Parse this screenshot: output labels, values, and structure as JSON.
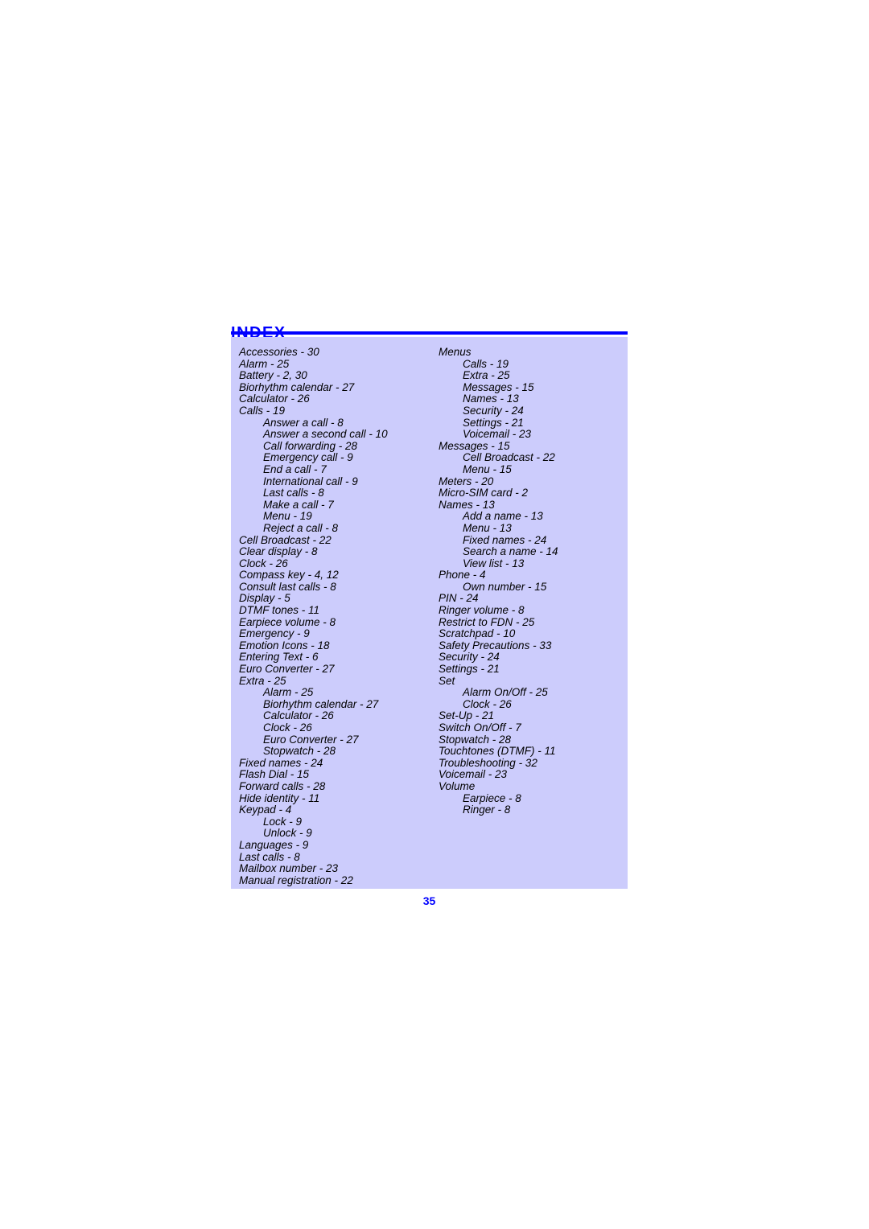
{
  "heading": {
    "title": "Index"
  },
  "page_number": "35",
  "colors": {
    "accent": "#0000FF",
    "panel_background": "#CCCCFC",
    "text": "#000000",
    "page_background": "#FFFFFF"
  },
  "index": {
    "left_column": [
      {
        "text": "Accessories - 30",
        "level": 0
      },
      {
        "text": "Alarm - 25",
        "level": 0
      },
      {
        "text": "Battery - 2, 30",
        "level": 0
      },
      {
        "text": "Biorhythm calendar - 27",
        "level": 0
      },
      {
        "text": "Calculator - 26",
        "level": 0
      },
      {
        "text": "Calls - 19",
        "level": 0
      },
      {
        "text": "Answer a call - 8",
        "level": 1
      },
      {
        "text": "Answer a second call - 10",
        "level": 1
      },
      {
        "text": "Call forwarding - 28",
        "level": 1
      },
      {
        "text": "Emergency call - 9",
        "level": 1
      },
      {
        "text": "End a call - 7",
        "level": 1
      },
      {
        "text": "International call - 9",
        "level": 1
      },
      {
        "text": "Last calls - 8",
        "level": 1
      },
      {
        "text": "Make a call - 7",
        "level": 1
      },
      {
        "text": "Menu - 19",
        "level": 1
      },
      {
        "text": "Reject a call - 8",
        "level": 1
      },
      {
        "text": "Cell Broadcast - 22",
        "level": 0
      },
      {
        "text": "Clear display - 8",
        "level": 0
      },
      {
        "text": "Clock - 26",
        "level": 0
      },
      {
        "text": "Compass key - 4, 12",
        "level": 0
      },
      {
        "text": "Consult last calls - 8",
        "level": 0
      },
      {
        "text": "Display - 5",
        "level": 0
      },
      {
        "text": "DTMF tones - 11",
        "level": 0
      },
      {
        "text": "Earpiece volume - 8",
        "level": 0
      },
      {
        "text": "Emergency - 9",
        "level": 0
      },
      {
        "text": "Emotion Icons - 18",
        "level": 0
      },
      {
        "text": "Entering Text - 6",
        "level": 0
      },
      {
        "text": "Euro Converter - 27",
        "level": 0
      },
      {
        "text": "Extra - 25",
        "level": 0
      },
      {
        "text": "Alarm - 25",
        "level": 1
      },
      {
        "text": "Biorhythm calendar - 27",
        "level": 1
      },
      {
        "text": "Calculator - 26",
        "level": 1
      },
      {
        "text": "Clock - 26",
        "level": 1
      },
      {
        "text": "Euro Converter - 27",
        "level": 1
      },
      {
        "text": "Stopwatch - 28",
        "level": 1
      },
      {
        "text": "Fixed names - 24",
        "level": 0
      },
      {
        "text": "Flash Dial - 15",
        "level": 0
      },
      {
        "text": "Forward calls - 28",
        "level": 0
      },
      {
        "text": "Hide identity - 11",
        "level": 0
      },
      {
        "text": "Keypad - 4",
        "level": 0
      },
      {
        "text": "Lock - 9",
        "level": 1
      },
      {
        "text": "Unlock - 9",
        "level": 1
      },
      {
        "text": "Languages - 9",
        "level": 0
      },
      {
        "text": "Last calls - 8",
        "level": 0
      },
      {
        "text": "Mailbox number - 23",
        "level": 0
      },
      {
        "text": "Manual registration - 22",
        "level": 0
      }
    ],
    "right_column": [
      {
        "text": "Menus",
        "level": 0
      },
      {
        "text": "Calls - 19",
        "level": 1
      },
      {
        "text": "Extra - 25",
        "level": 1
      },
      {
        "text": "Messages - 15",
        "level": 1
      },
      {
        "text": "Names - 13",
        "level": 1
      },
      {
        "text": "Security - 24",
        "level": 1
      },
      {
        "text": "Settings - 21",
        "level": 1
      },
      {
        "text": "Voicemail - 23",
        "level": 1
      },
      {
        "text": "Messages - 15",
        "level": 0
      },
      {
        "text": "Cell Broadcast - 22",
        "level": 1
      },
      {
        "text": "Menu - 15",
        "level": 1
      },
      {
        "text": "Meters - 20",
        "level": 0
      },
      {
        "text": "Micro-SIM card - 2",
        "level": 0
      },
      {
        "text": "Names - 13",
        "level": 0
      },
      {
        "text": "Add a name - 13",
        "level": 1
      },
      {
        "text": "Menu - 13",
        "level": 1
      },
      {
        "text": "Fixed names - 24",
        "level": 1
      },
      {
        "text": "Search a name - 14",
        "level": 1
      },
      {
        "text": "View list - 13",
        "level": 1
      },
      {
        "text": "Phone - 4",
        "level": 0
      },
      {
        "text": "Own number - 15",
        "level": 1
      },
      {
        "text": "PIN - 24",
        "level": 0
      },
      {
        "text": "Ringer volume - 8",
        "level": 0
      },
      {
        "text": "Restrict to FDN - 25",
        "level": 0
      },
      {
        "text": "Scratchpad - 10",
        "level": 0
      },
      {
        "text": "Safety Precautions - 33",
        "level": 0
      },
      {
        "text": "Security - 24",
        "level": 0
      },
      {
        "text": "Settings - 21",
        "level": 0
      },
      {
        "text": "Set",
        "level": 0
      },
      {
        "text": "Alarm On/Off - 25",
        "level": 1
      },
      {
        "text": "Clock - 26",
        "level": 1
      },
      {
        "text": "Set-Up - 21",
        "level": 0
      },
      {
        "text": "Switch On/Off - 7",
        "level": 0
      },
      {
        "text": "Stopwatch - 28",
        "level": 0
      },
      {
        "text": "Touchtones (DTMF) - 11",
        "level": 0
      },
      {
        "text": "Troubleshooting - 32",
        "level": 0
      },
      {
        "text": "Voicemail - 23",
        "level": 0
      },
      {
        "text": "Volume",
        "level": 0
      },
      {
        "text": "Earpiece - 8",
        "level": 1
      },
      {
        "text": "Ringer - 8",
        "level": 1
      }
    ]
  }
}
